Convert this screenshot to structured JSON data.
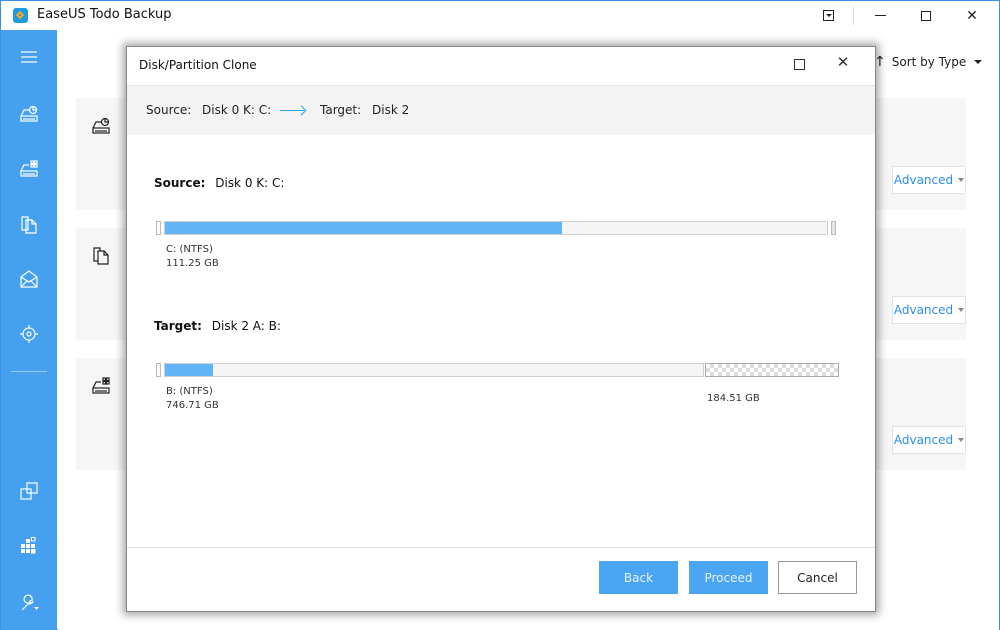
{
  "window": {
    "title": "EaseUS Todo Backup",
    "controls": [
      "menu",
      "minimize",
      "maximize",
      "close"
    ]
  },
  "sidebar": {
    "items": [
      {
        "icon": "menu-icon"
      },
      {
        "icon": "disk-backup-icon"
      },
      {
        "icon": "system-backup-icon"
      },
      {
        "icon": "file-backup-icon"
      },
      {
        "icon": "mail-backup-icon"
      },
      {
        "icon": "smart-backup-icon"
      },
      {
        "icon": "clone-icon"
      },
      {
        "icon": "tools-icon"
      },
      {
        "icon": "wrench-settings-icon"
      }
    ]
  },
  "main": {
    "sort_label": "Sort by Type",
    "cards": [
      {
        "icon": "disk-backup-icon",
        "advanced_label": "Advanced"
      },
      {
        "icon": "file-backup-icon",
        "advanced_label": "Advanced"
      },
      {
        "icon": "system-backup-icon",
        "advanced_label": "Advanced"
      }
    ]
  },
  "dialog": {
    "title": "Disk/Partition Clone",
    "path": {
      "source_label": "Source:",
      "source_value": "Disk 0 K: C:",
      "target_label": "Target:",
      "target_value": "Disk 2"
    },
    "source": {
      "label": "Source:",
      "value": "Disk 0 K: C:",
      "partitions": [
        {
          "name": "C: (NTFS)",
          "size": "111.25 GB",
          "used_fraction": 0.6
        }
      ]
    },
    "target": {
      "label": "Target:",
      "value": "Disk 2 A: B:",
      "partitions": [
        {
          "name": "B: (NTFS)",
          "size": "746.71 GB",
          "used_fraction": 0.09
        }
      ],
      "unallocated": {
        "size": "184.51 GB"
      }
    },
    "buttons": {
      "back": "Back",
      "proceed": "Proceed",
      "cancel": "Cancel"
    }
  }
}
